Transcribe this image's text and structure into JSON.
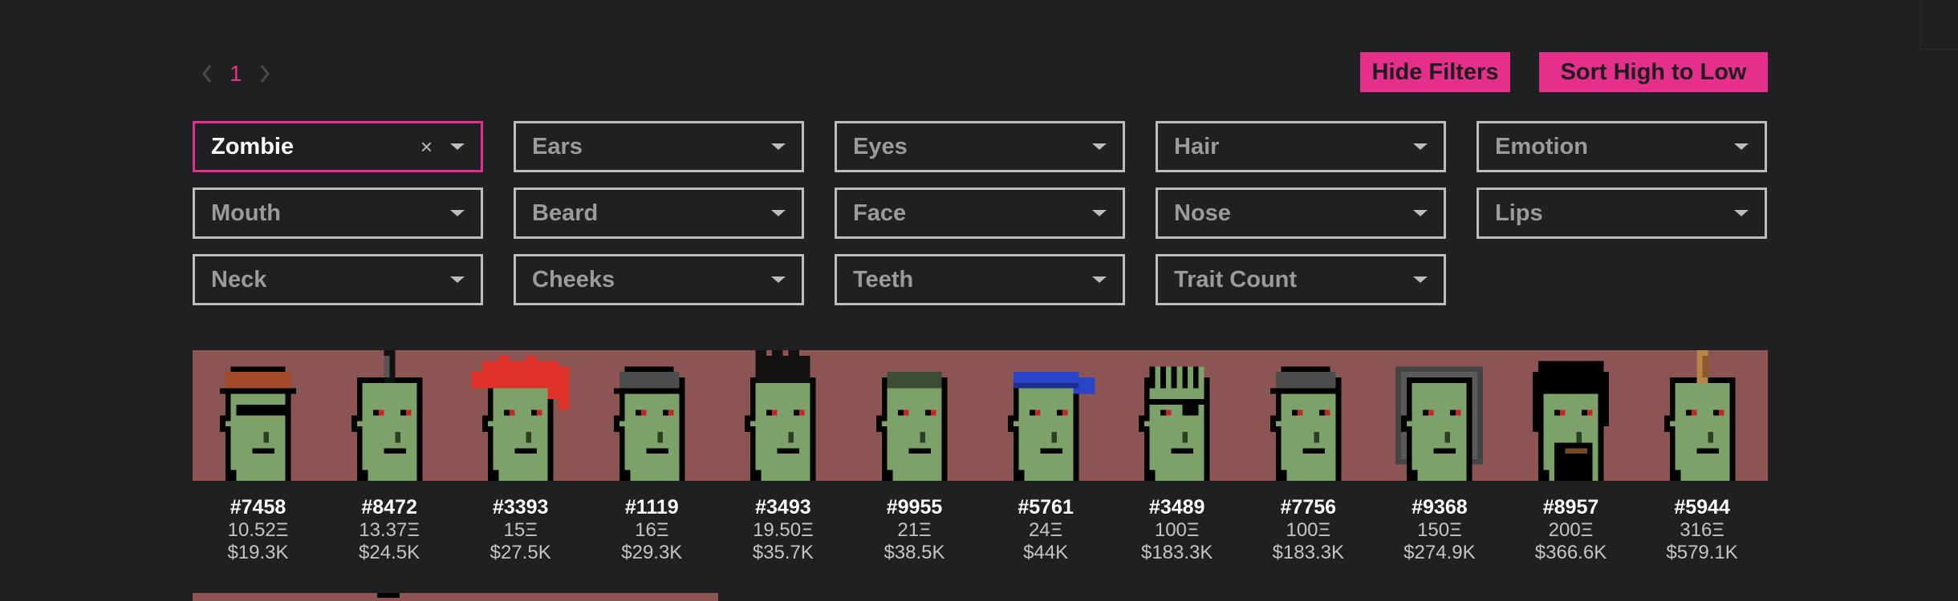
{
  "pagination": {
    "current_page": "1"
  },
  "buttons": {
    "hide_filters": "Hide Filters",
    "sort": "Sort High to Low"
  },
  "filters": [
    {
      "label": "Zombie",
      "active": true
    },
    {
      "label": "Ears"
    },
    {
      "label": "Eyes"
    },
    {
      "label": "Hair"
    },
    {
      "label": "Emotion"
    },
    {
      "label": "Mouth"
    },
    {
      "label": "Beard"
    },
    {
      "label": "Face"
    },
    {
      "label": "Nose"
    },
    {
      "label": "Lips"
    },
    {
      "label": "Neck"
    },
    {
      "label": "Cheeks"
    },
    {
      "label": "Teeth"
    },
    {
      "label": "Trait Count"
    }
  ],
  "filter_clear_symbol": "×",
  "colors": {
    "accent": "#e52f8a",
    "strip_background": "#8c5452",
    "zombie_skin": "#7da269"
  },
  "punks": [
    {
      "id": "#7458",
      "eth": "10.52Ξ",
      "usd": "$19.3K",
      "headwear": "knitted-cap",
      "eyes": "shades"
    },
    {
      "id": "#8472",
      "eth": "13.37Ξ",
      "usd": "$24.5K",
      "headwear": "mohawk-dark",
      "eyes": "plain"
    },
    {
      "id": "#3393",
      "eth": "15Ξ",
      "usd": "$27.5K",
      "headwear": "wild-hair-red",
      "eyes": "plain"
    },
    {
      "id": "#1119",
      "eth": "16Ξ",
      "usd": "$29.3K",
      "headwear": "cap",
      "eyes": "plain"
    },
    {
      "id": "#3493",
      "eth": "19.50Ξ",
      "usd": "$35.7K",
      "headwear": "spiky-hair",
      "eyes": "plain"
    },
    {
      "id": "#9955",
      "eth": "21Ξ",
      "usd": "$38.5K",
      "headwear": "short-hair",
      "eyes": "plain"
    },
    {
      "id": "#5761",
      "eth": "24Ξ",
      "usd": "$44K",
      "headwear": "bandana-blue",
      "eyes": "plain"
    },
    {
      "id": "#3489",
      "eth": "100Ξ",
      "usd": "$183.3K",
      "headwear": "frumpy-hair",
      "eyes": "eye-patch"
    },
    {
      "id": "#7756",
      "eth": "100Ξ",
      "usd": "$183.3K",
      "headwear": "cap",
      "eyes": "plain"
    },
    {
      "id": "#9368",
      "eth": "150Ξ",
      "usd": "$274.9K",
      "headwear": "hoodie",
      "eyes": "plain"
    },
    {
      "id": "#8957",
      "eth": "200Ξ",
      "usd": "$366.6K",
      "headwear": "black-hair",
      "eyes": "plain"
    },
    {
      "id": "#5944",
      "eth": "316Ξ",
      "usd": "$579.1K",
      "headwear": "mohawk-thin",
      "eyes": "plain"
    }
  ]
}
